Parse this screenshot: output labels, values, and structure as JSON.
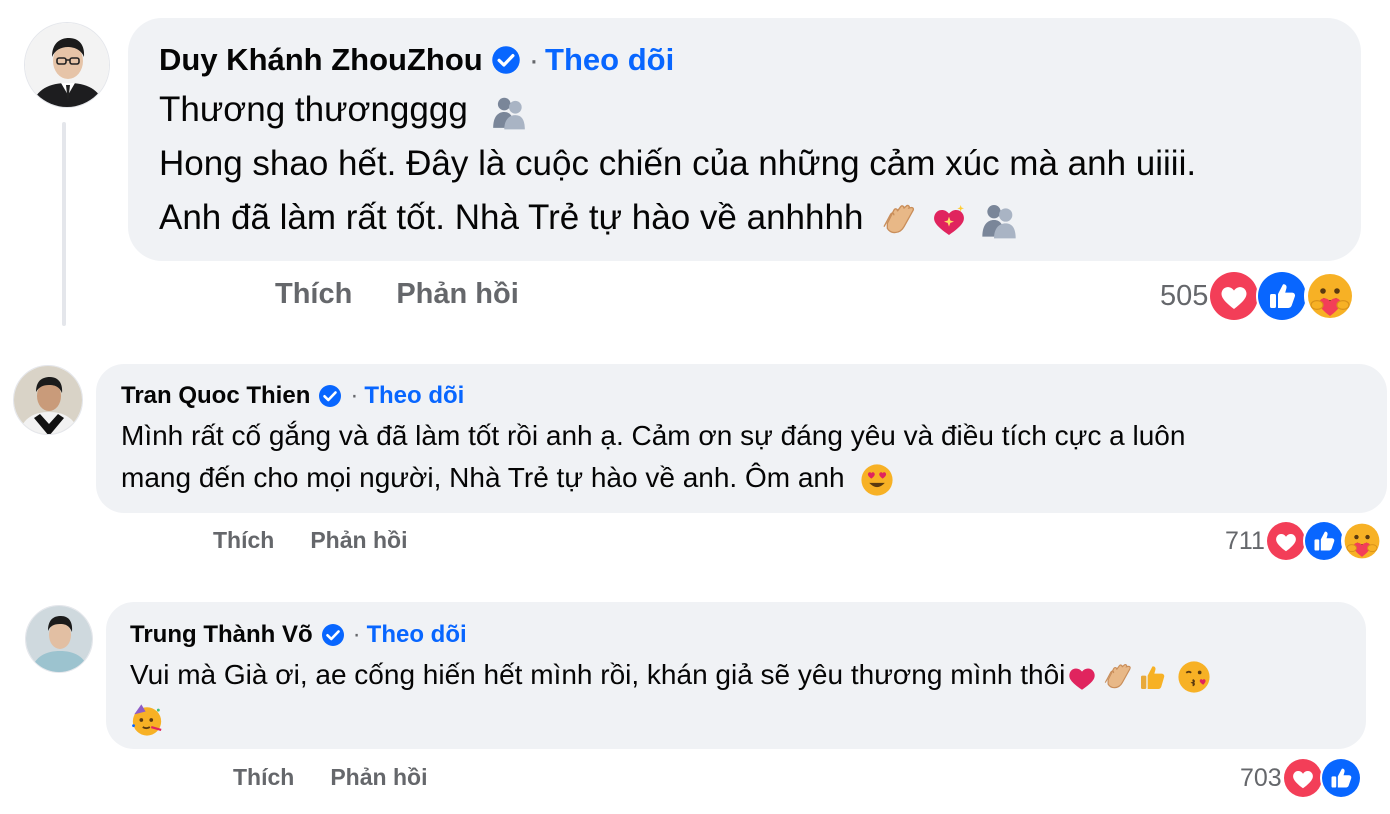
{
  "colors": {
    "link": "#0866ff",
    "secondary_text": "#65676b",
    "bubble": "#f0f2f5",
    "love": "#f33e58",
    "like": "#0866ff",
    "care": "#f7b125"
  },
  "comments": [
    {
      "name": "Duy Khánh ZhouZhou",
      "separator": "·",
      "follow": "Theo dõi",
      "lines": [
        "Thương thươngggg",
        "Hong shao hết. Đây là cuộc chiến của những cảm xúc mà anh uiiii.",
        "Anh đã làm rất tốt. Nhà Trẻ tự hào về anhhhh"
      ],
      "emoji_line1": [
        "hug-people-icon"
      ],
      "emoji_line3": [
        "clapping-hands-icon",
        "sparkling-heart-icon",
        "hug-people-icon"
      ],
      "like": "Thích",
      "reply": "Phản hồi",
      "reaction_count": "505",
      "reactions": [
        "love-reaction-icon",
        "like-reaction-icon",
        "care-reaction-icon"
      ]
    },
    {
      "name": "Tran Quoc Thien",
      "separator": "·",
      "follow": "Theo dõi",
      "lines": [
        "Mình rất cố gắng và đã làm tốt rồi anh ạ. Cảm ơn sự đáng yêu và điều tích cực a luôn",
        "mang đến cho mọi người, Nhà Trẻ tự hào về anh. Ôm anh"
      ],
      "emoji_line2": [
        "heart-eyes-face-icon"
      ],
      "like": "Thích",
      "reply": "Phản hồi",
      "reaction_count": "711",
      "reactions": [
        "love-reaction-icon",
        "like-reaction-icon",
        "care-reaction-icon"
      ]
    },
    {
      "name": "Trung Thành Võ",
      "separator": "·",
      "follow": "Theo dõi",
      "lines": [
        "Vui mà Già ơi, ae cống hiến hết mình rồi, khán giả sẽ yêu thương mình thôi"
      ],
      "emoji_line1": [
        "red-heart-icon",
        "clapping-hands-icon",
        "thumbs-up-icon",
        "kissing-face-icon"
      ],
      "emoji_line2": [
        "partying-face-icon"
      ],
      "like": "Thích",
      "reply": "Phản hồi",
      "reaction_count": "703",
      "reactions": [
        "love-reaction-icon",
        "like-reaction-icon"
      ]
    }
  ]
}
